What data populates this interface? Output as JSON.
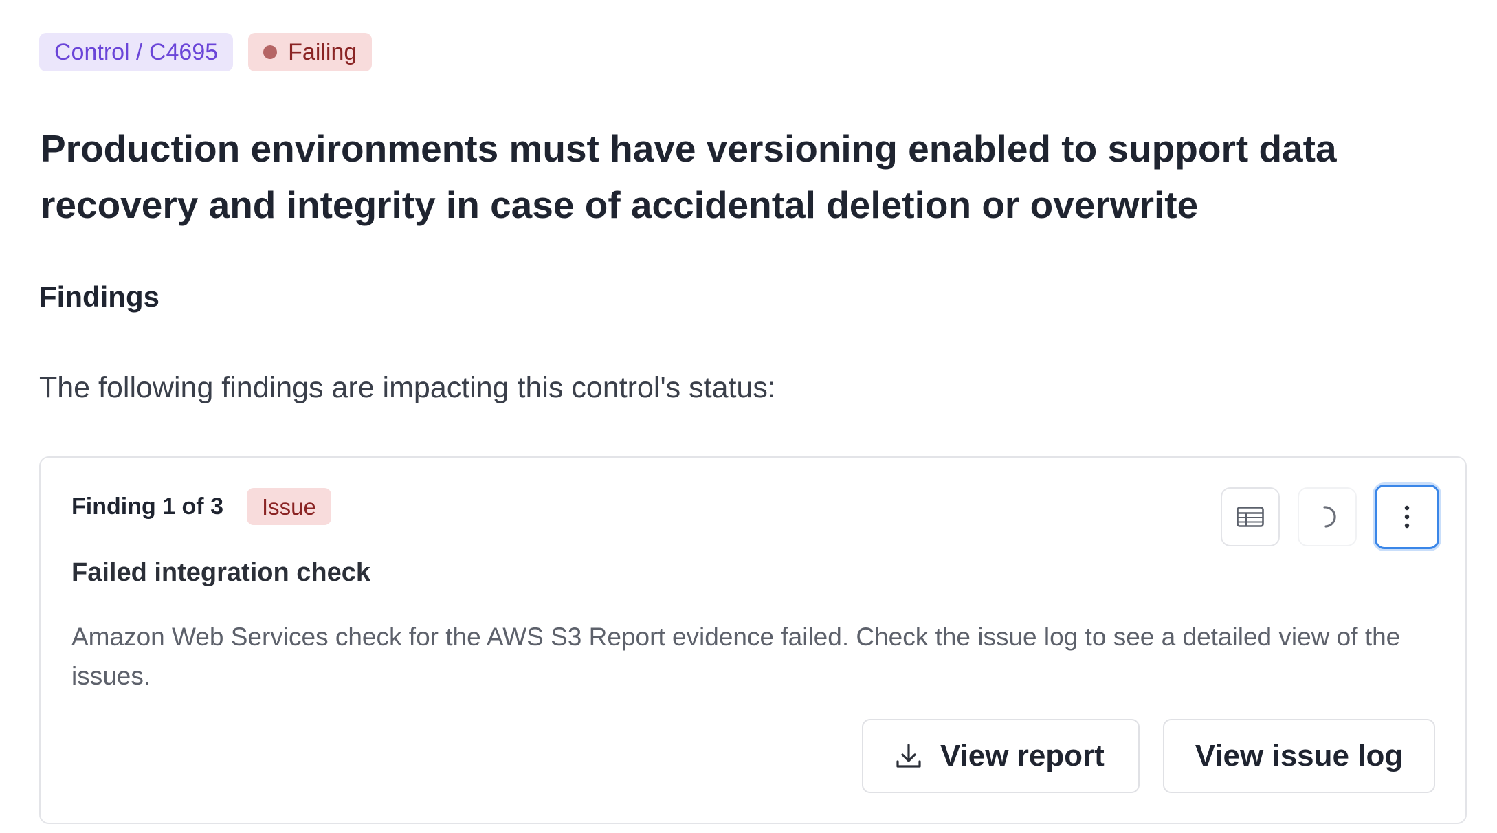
{
  "header": {
    "control_badge": "Control / C4695",
    "status_badge": "Failing",
    "title": "Production environments must have versioning enabled to support data recovery and integrity in case of accidental deletion or overwrite"
  },
  "findings": {
    "heading": "Findings",
    "intro": "The following findings are impacting this control's status:",
    "card": {
      "count_label": "Finding 1 of 3",
      "type_badge": "Issue",
      "title": "Failed integration check",
      "description": "Amazon Web Services check for the AWS S3 Report evidence failed. Check the issue log to see a detailed view of the issues.",
      "icons": [
        "table-icon",
        "loading-spinner-icon",
        "more-vertical-icon"
      ],
      "actions": {
        "view_report": "View report",
        "view_issue_log": "View issue log"
      }
    }
  },
  "colors": {
    "control_badge_bg": "#ebe6fb",
    "control_badge_text": "#6a45d8",
    "failing_badge_bg": "#f8dcdc",
    "failing_badge_text": "#8a2424",
    "focus_ring": "#3a86e8"
  }
}
